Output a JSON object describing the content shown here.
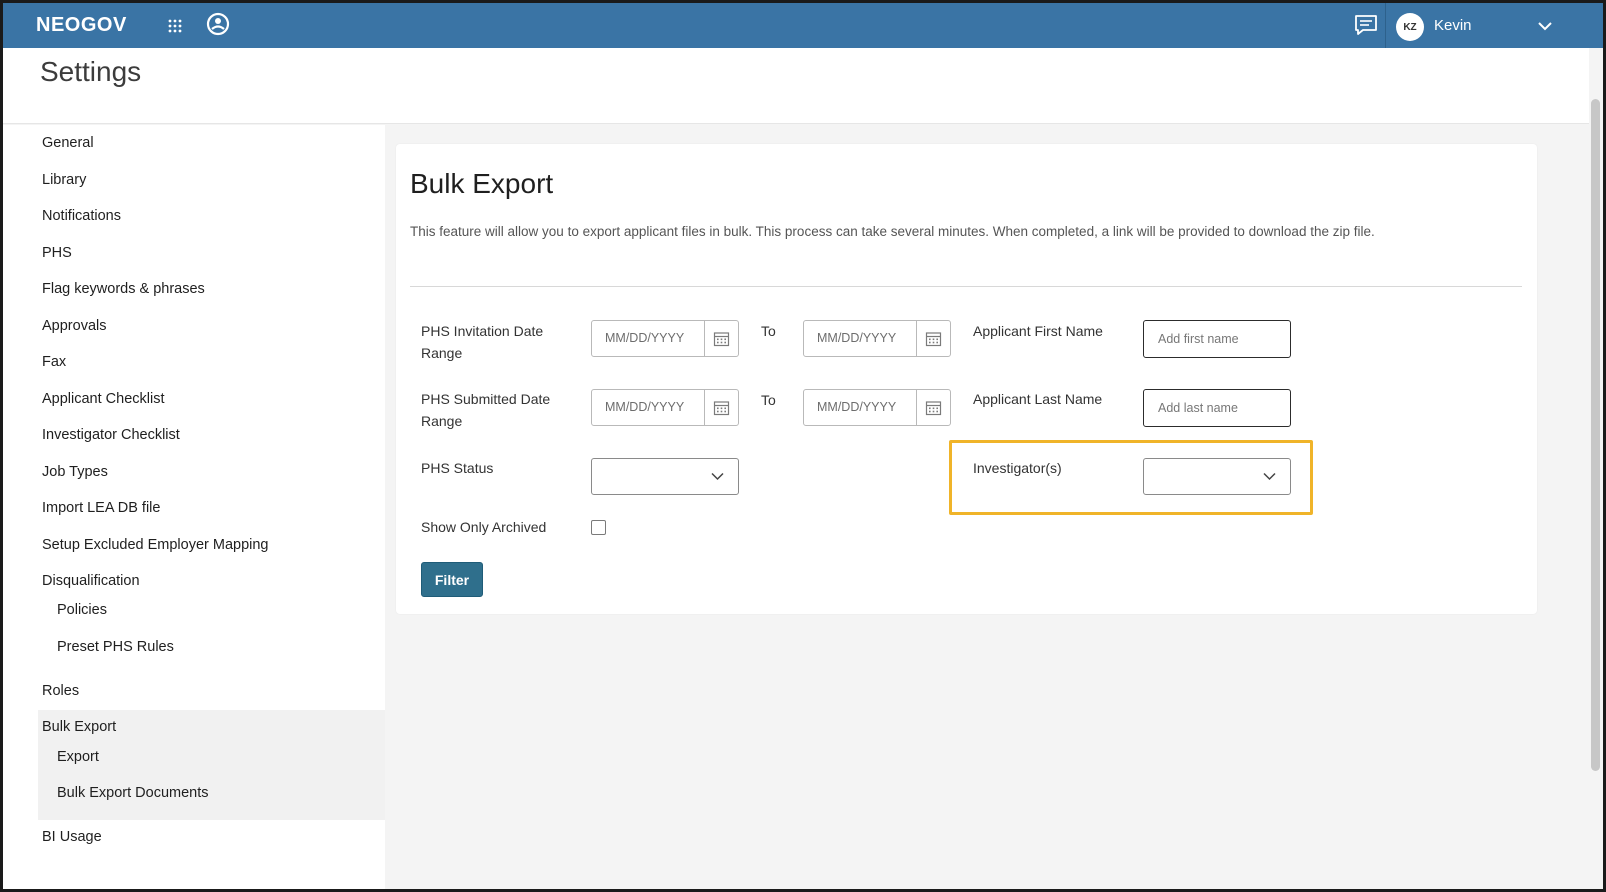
{
  "app": {
    "brand": "NEOGOV",
    "icons": {
      "apps": "apps-grid-icon",
      "support": "support-icon",
      "chat": "chat-icon"
    },
    "colors": {
      "topbar": "#3a74a5",
      "accent_button": "#2f6f8c",
      "highlight": "#f0b429"
    }
  },
  "user": {
    "initials": "KZ",
    "name": "Kevin"
  },
  "page": {
    "title": "Settings"
  },
  "sidebar": {
    "items": [
      {
        "label": "General"
      },
      {
        "label": "Library"
      },
      {
        "label": "Notifications"
      },
      {
        "label": "PHS"
      },
      {
        "label": "Flag keywords & phrases"
      },
      {
        "label": "Approvals"
      },
      {
        "label": "Fax"
      },
      {
        "label": "Applicant Checklist"
      },
      {
        "label": "Investigator Checklist"
      },
      {
        "label": "Job Types"
      },
      {
        "label": "Import LEA DB file"
      },
      {
        "label": "Setup Excluded Employer Mapping"
      },
      {
        "label": "Disqualification"
      },
      {
        "label": "Policies"
      },
      {
        "label": "Preset PHS Rules"
      },
      {
        "label": "Roles"
      },
      {
        "label": "Bulk Export"
      },
      {
        "label": "Export"
      },
      {
        "label": "Bulk Export Documents"
      },
      {
        "label": "BI Usage"
      }
    ],
    "active": "Bulk Export"
  },
  "bulk_export": {
    "title": "Bulk Export",
    "description": "This feature will allow you to export applicant files in bulk. This process can take several minutes. When completed, a link will be provided to download the zip file.",
    "fields": {
      "invitation_range_label_1": "PHS Invitation Date",
      "invitation_range_label_2": "Range",
      "submitted_range_label_1": "PHS Submitted Date",
      "submitted_range_label_2": "Range",
      "to_label": "To",
      "date_placeholder": "MM/DD/YYYY",
      "first_name_label": "Applicant First Name",
      "first_name_placeholder": "Add first name",
      "last_name_label": "Applicant Last Name",
      "last_name_placeholder": "Add last name",
      "status_label": "PHS Status",
      "status_value": "",
      "investigators_label": "Investigator(s)",
      "investigators_value": "",
      "archived_label": "Show Only Archived",
      "archived_checked": false
    },
    "filter_button": "Filter"
  }
}
